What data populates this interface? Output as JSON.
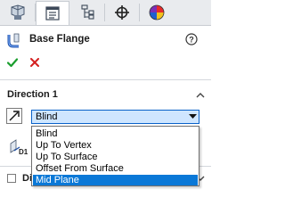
{
  "tabs": [
    {
      "name": "feature-manager",
      "icon": "feature-tree-icon"
    },
    {
      "name": "property-manager",
      "icon": "property-list-icon",
      "active": true
    },
    {
      "name": "configuration-manager",
      "icon": "configuration-icon"
    },
    {
      "name": "dimxpert-manager",
      "icon": "crosshair-icon"
    },
    {
      "name": "display-manager",
      "icon": "appearance-pie-icon"
    }
  ],
  "header": {
    "title": "Base Flange",
    "help_icon": "help-icon",
    "feature_icon": "base-flange-icon"
  },
  "actions": {
    "ok_icon": "check-icon",
    "cancel_icon": "close-icon"
  },
  "direction1": {
    "title": "Direction 1",
    "end_condition": "Blind",
    "options": [
      "Blind",
      "Up To Vertex",
      "Up To Surface",
      "Offset From Surface",
      "Mid Plane"
    ],
    "highlighted_index": 4
  },
  "direction2": {
    "title": "Di",
    "checked": false
  },
  "colors": {
    "accent": "#0a78d7",
    "combo_bg": "#cfe6ff",
    "ok_green": "#1a9e2e",
    "cancel_red": "#d42020"
  }
}
